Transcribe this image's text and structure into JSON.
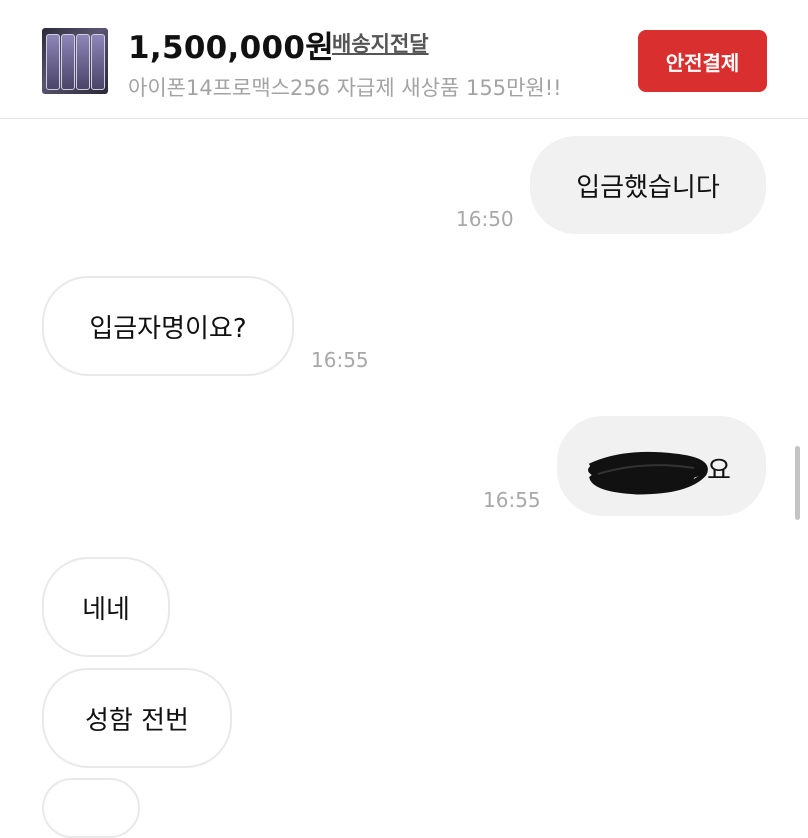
{
  "product": {
    "price": "1,500,000원",
    "shipping": "배송지전달",
    "title": "아이폰14프로맥스256 자급제 새상품 155만원!!",
    "pay_button": "안전결제"
  },
  "messages": [
    {
      "side": "out",
      "text": "입금했습니다",
      "time": "16:50"
    },
    {
      "side": "in",
      "text": "입금자명이요?",
      "time": "16:55"
    },
    {
      "side": "out",
      "text": "",
      "time": "16:55"
    },
    {
      "side": "in",
      "text": "네네",
      "time": ""
    },
    {
      "side": "in",
      "text": "성함 전번",
      "time": ""
    }
  ],
  "redacted_suffix": "요",
  "colors": {
    "accent": "#d9302f",
    "bubble_out": "#f1f1f1",
    "bubble_in_border": "#e9e9e9",
    "timestamp": "#a8a8a8"
  }
}
